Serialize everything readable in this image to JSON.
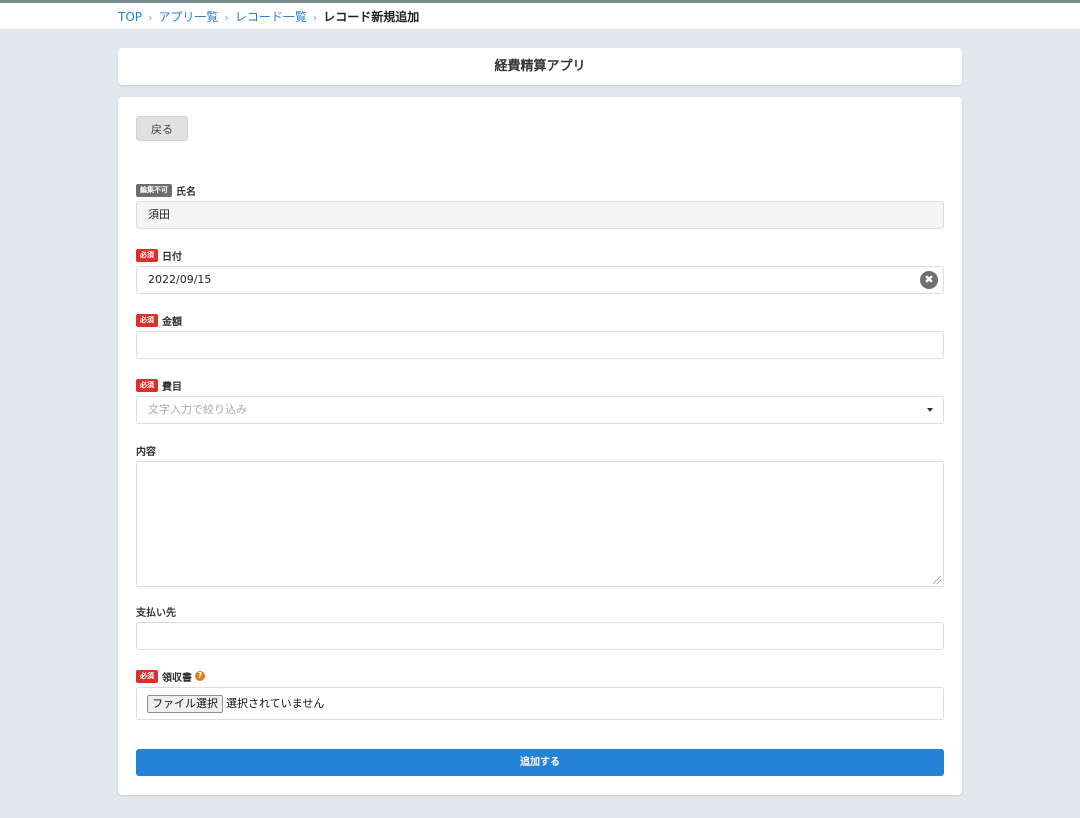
{
  "breadcrumb": {
    "items": [
      "TOP",
      "アプリ一覧",
      "レコード一覧"
    ],
    "separator": "›",
    "current": "レコード新規追加"
  },
  "app": {
    "title": "経費精算アプリ"
  },
  "form": {
    "back_label": "戻る",
    "fields": {
      "name": {
        "label": "氏名",
        "badge": "編集不可",
        "value": "須田"
      },
      "date": {
        "label": "日付",
        "badge": "必須",
        "value": "2022/09/15",
        "clear_icon": "✖"
      },
      "amount": {
        "label": "金額",
        "badge": "必須",
        "value": ""
      },
      "category": {
        "label": "費目",
        "badge": "必須",
        "placeholder": "文字入力で絞り込み"
      },
      "content": {
        "label": "内容",
        "value": ""
      },
      "payee": {
        "label": "支払い先",
        "value": ""
      },
      "receipt": {
        "label": "領収書",
        "badge": "必須",
        "help": "?",
        "file_button": "ファイル選択",
        "file_status": "選択されていません"
      }
    },
    "submit_label": "追加する"
  },
  "colors": {
    "background": "#e3e8ef",
    "link": "#2a7fd4",
    "required_badge": "#d9302c",
    "readonly_badge": "#6d6d6d",
    "primary_button": "#2383d4",
    "help_icon": "#e07b1a"
  }
}
